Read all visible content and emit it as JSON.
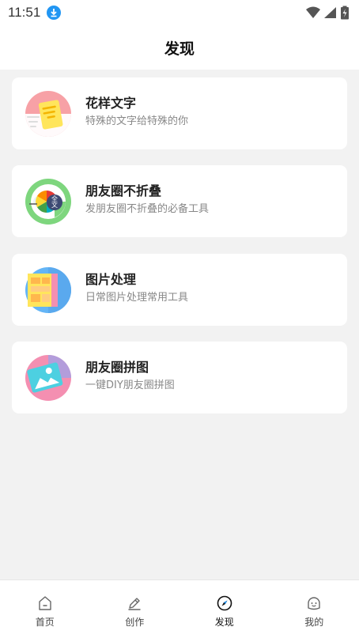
{
  "status_bar": {
    "time": "11:51"
  },
  "header": {
    "title": "发现"
  },
  "cards": [
    {
      "title": "花样文字",
      "subtitle": "特殊的文字给特殊的你"
    },
    {
      "title": "朋友圈不折叠",
      "subtitle": "发朋友圈不折叠的必备工具",
      "icon_text_top": "全",
      "icon_text_bottom": "文"
    },
    {
      "title": "图片处理",
      "subtitle": "日常图片处理常用工具"
    },
    {
      "title": "朋友圈拼图",
      "subtitle": "一键DIY朋友圈拼图"
    }
  ],
  "tabbar": {
    "tabs": [
      {
        "label": "首页",
        "icon": "home-icon"
      },
      {
        "label": "创作",
        "icon": "pencil-icon"
      },
      {
        "label": "发现",
        "icon": "compass-icon",
        "active": true
      },
      {
        "label": "我的",
        "icon": "profile-face-icon"
      }
    ]
  },
  "colors": {
    "accent_blue": "#2196f3",
    "background": "#f2f2f2"
  }
}
